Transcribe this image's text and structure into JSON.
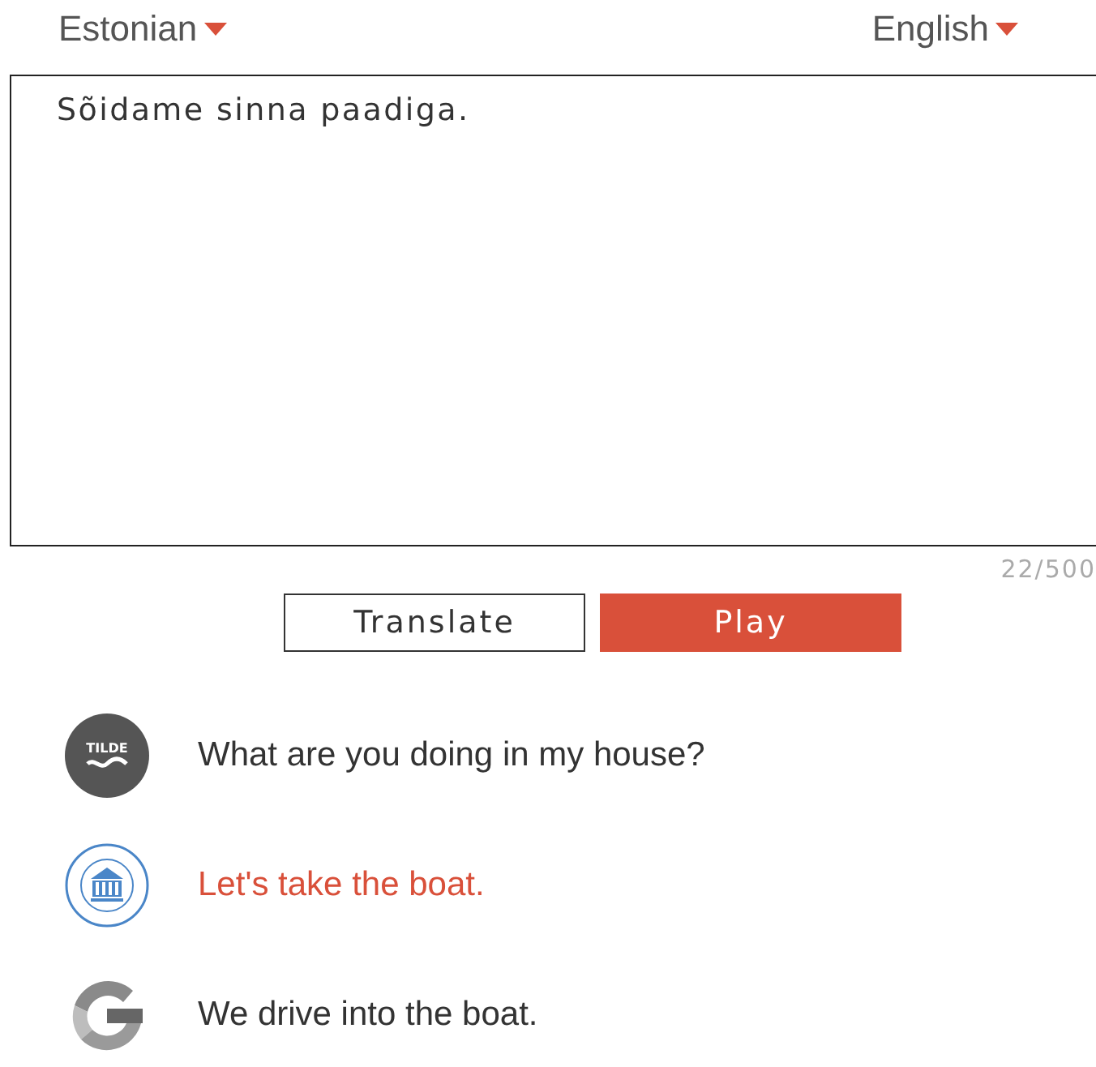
{
  "languages": [
    {
      "label": "Estonian"
    },
    {
      "label": "English"
    }
  ],
  "source": {
    "value": "Sõidame sinna paadiga.",
    "counter": "22/500"
  },
  "buttons": [
    {
      "label": "Translate",
      "kind": "outline"
    },
    {
      "label": "Play",
      "kind": "primary"
    }
  ],
  "results": [
    {
      "kind": "tilde",
      "logo_text": "TILDE",
      "text": "What are you doing in my house?",
      "selected": false
    },
    {
      "kind": "seal",
      "text": "Let's take the boat.",
      "selected": true
    },
    {
      "kind": "google",
      "text": "We drive into the boat.",
      "selected": false
    }
  ]
}
